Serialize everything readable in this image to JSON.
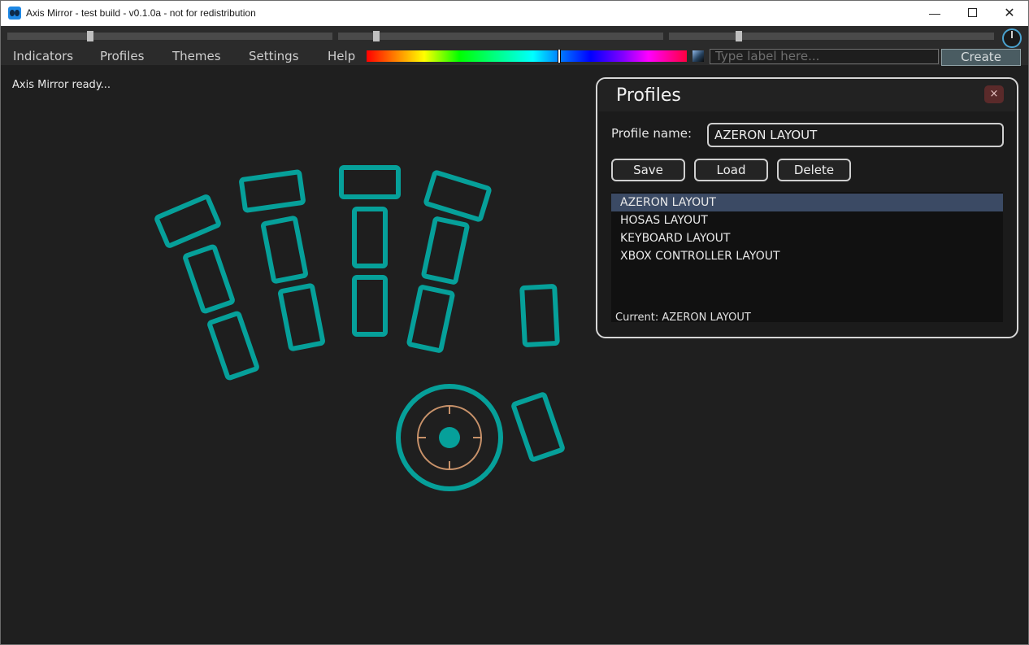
{
  "window": {
    "title": "Axis Mirror - test build - v0.1.0a - not for redistribution",
    "minimize": "—",
    "close": "✕"
  },
  "toolbar": {
    "sliders": [
      {
        "value": 0.25
      },
      {
        "value": 0.11
      },
      {
        "value": 0.21
      }
    ],
    "menu": [
      "Indicators",
      "Profiles",
      "Themes",
      "Settings",
      "Help"
    ],
    "hue_value": 0.6,
    "label_placeholder": "Type label here...",
    "create_label": "Create"
  },
  "status": "Axis Mirror ready...",
  "colors": {
    "accent": "#06a09a",
    "crosshair": "#c8926a",
    "background": "#1f1f1f"
  },
  "profiles_panel": {
    "title": "Profiles",
    "close_label": "×",
    "name_label": "Profile name:",
    "name_value": "AZERON LAYOUT",
    "save_label": "Save",
    "load_label": "Load",
    "delete_label": "Delete",
    "items": [
      "AZERON LAYOUT",
      "HOSAS LAYOUT",
      "KEYBOARD LAYOUT",
      "XBOX CONTROLLER LAYOUT"
    ],
    "selected_index": 0,
    "current_text": "Current: AZERON LAYOUT"
  }
}
